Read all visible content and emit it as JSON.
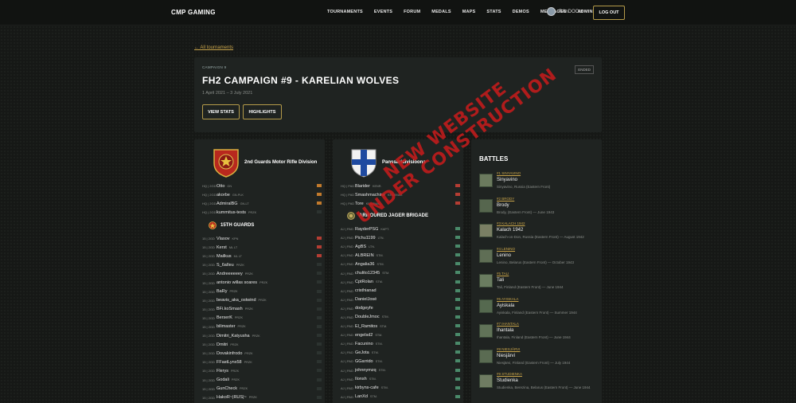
{
  "nav": {
    "brand": "CMP GAMING",
    "items": [
      "TOURNAMENTS",
      "EVENTS",
      "FORUM",
      "MEDALS",
      "MAPS",
      "STATS",
      "DEMOS",
      "MESSAGES",
      "ADMIN"
    ],
    "username": "RAnDOOm",
    "logout": "LOG OUT"
  },
  "back_link": "← All tournaments",
  "hero": {
    "kicker": "CAMPAIGN 9",
    "title": "FH2 CAMPAIGN #9 - KARELIAN WOLVES",
    "dates": "1 April 2021 – 3 July 2021",
    "badge": "ENDED",
    "view_stats": "VIEW STATS",
    "highlights": "HIGHLIGHTS"
  },
  "faction1": {
    "name": "2nd Guards Motor Rifle Division",
    "hq": [
      {
        "pos": "HQ | 2GD",
        "name": "Otto",
        "rank": "GN",
        "bar": "or"
      },
      {
        "pos": "HQ | 2GD",
        "name": "akorbe",
        "rank": "GN-PLK",
        "bar": "or"
      },
      {
        "pos": "HQ | 2GD",
        "name": "AdmiralBG",
        "rank": "GN-LT",
        "bar": "or"
      },
      {
        "pos": "HQ | 2GD",
        "name": "kummitus-tests",
        "rank": "PRZK",
        "bar": ""
      }
    ],
    "unit": "15TH GUARDS",
    "members": [
      {
        "pos": "15 | 2GD",
        "name": "Vlasov",
        "rank": "KPN",
        "bar": "rd"
      },
      {
        "pos": "15 | 2GD",
        "name": "Kerst",
        "rank": "ML LT",
        "bar": "rd"
      },
      {
        "pos": "15 | 2GD",
        "name": "Mailkus",
        "rank": "ML LT",
        "bar": "rd"
      },
      {
        "pos": "15 | 2GD",
        "name": "S_6aIleu",
        "rank": "PRZK",
        "bar": ""
      },
      {
        "pos": "15 | 2GD",
        "name": "Andreeeeeey",
        "rank": "PRZK",
        "bar": ""
      },
      {
        "pos": "15 | 2GD",
        "name": "antonio willas soares",
        "rank": "PRZK",
        "bar": ""
      },
      {
        "pos": "15 | 2GD",
        "name": "BaRy",
        "rank": "PRZK",
        "bar": ""
      },
      {
        "pos": "15 | 2GD",
        "name": "beavis_aka_ostwind",
        "rank": "PRZK",
        "bar": ""
      },
      {
        "pos": "15 | 2GD",
        "name": "BFi.koSmash",
        "rank": "PRZK",
        "bar": ""
      },
      {
        "pos": "15 | 2GD",
        "name": "BerserK",
        "rank": "PRZK",
        "bar": ""
      },
      {
        "pos": "15 | 2GD",
        "name": "bilimaster",
        "rank": "PRZK",
        "bar": ""
      },
      {
        "pos": "15 | 2GD",
        "name": "Dimitri_Katyusha",
        "rank": "PRZK",
        "bar": ""
      },
      {
        "pos": "15 | 2GD",
        "name": "Dmitri",
        "rank": "PRZK",
        "bar": ""
      },
      {
        "pos": "15 | 2GD",
        "name": "Dovakinfrodo",
        "rank": "PRZK",
        "bar": ""
      },
      {
        "pos": "15 | 2GD",
        "name": "FFastLynx58",
        "rank": "PRZK",
        "bar": ""
      },
      {
        "pos": "15 | 2GD",
        "name": "Flerys",
        "rank": "PRZK",
        "bar": ""
      },
      {
        "pos": "15 | 2GD",
        "name": "Godali",
        "rank": "PRZK",
        "bar": ""
      },
      {
        "pos": "15 | 2GD",
        "name": "GunCheck",
        "rank": "PRZK",
        "bar": ""
      },
      {
        "pos": "15 | 2GD",
        "name": "HakoR~|RUS|~",
        "rank": "PRZK",
        "bar": ""
      }
    ]
  },
  "faction2": {
    "name": "Panssaridivisioona",
    "hq": [
      {
        "pos": "HQ | PAD",
        "name": "Blarider",
        "rank": "KENR.",
        "bar": "rd"
      },
      {
        "pos": "HQ | PAD",
        "name": "Smashmachine",
        "rank": "KENRMAJ.",
        "bar": "rd"
      },
      {
        "pos": "HQ | PAD",
        "name": "Tore",
        "rank": "KENRMAJ.",
        "bar": "rd"
      }
    ],
    "unit": "ARMOURED JAGER BRIGADE",
    "members": [
      {
        "pos": "AJ | PAD",
        "name": "RayderPSG",
        "rank": "KAPT.",
        "bar": "gr"
      },
      {
        "pos": "AJ | PAD",
        "name": "Pichu1199",
        "rank": "LTN.",
        "bar": "gr"
      },
      {
        "pos": "AJ | PAD",
        "name": "AgBS",
        "rank": "LTN.",
        "bar": "gr"
      },
      {
        "pos": "AJ | PAD",
        "name": "ALBREIN",
        "rank": "STM.",
        "bar": "gr"
      },
      {
        "pos": "AJ | PAD",
        "name": "Angalia36",
        "rank": "STM.",
        "bar": "gr"
      },
      {
        "pos": "AJ | PAD",
        "name": "chulito12345",
        "rank": "STM.",
        "bar": "gr"
      },
      {
        "pos": "AJ | PAD",
        "name": "CptRolan",
        "rank": "STM.",
        "bar": "gr"
      },
      {
        "pos": "AJ | PAD",
        "name": "cristhianad",
        "rank": "",
        "bar": "gr"
      },
      {
        "pos": "AJ | PAD",
        "name": "DanielJosé",
        "rank": "",
        "bar": "gr"
      },
      {
        "pos": "AJ | PAD",
        "name": "dodgeyfe",
        "rank": "",
        "bar": "gr"
      },
      {
        "pos": "AJ | PAD",
        "name": "DoubleJmoc",
        "rank": "STM.",
        "bar": "gr"
      },
      {
        "pos": "AJ | PAD",
        "name": "El_Ramitos",
        "rank": "STM.",
        "bar": "gr"
      },
      {
        "pos": "AJ | PAD",
        "name": "engelsd2",
        "rank": "STM.",
        "bar": "gr"
      },
      {
        "pos": "AJ | PAD",
        "name": "Facunino",
        "rank": "STM.",
        "bar": "gr"
      },
      {
        "pos": "AJ | PAD",
        "name": "GeJota",
        "rank": "STM.",
        "bar": "gr"
      },
      {
        "pos": "AJ | PAD",
        "name": "GGarrido",
        "rank": "STM.",
        "bar": "gr"
      },
      {
        "pos": "AJ | PAD",
        "name": "johnnymzq",
        "rank": "STM.",
        "bar": "gr"
      },
      {
        "pos": "AJ | PAD",
        "name": "Ilonsh",
        "rank": "STM.",
        "bar": "gr"
      },
      {
        "pos": "AJ | PAD",
        "name": "kirbyns-cafe",
        "rank": "STM.",
        "bar": "gr"
      },
      {
        "pos": "AJ | PAD",
        "name": "LanXd",
        "rank": "STM.",
        "bar": "gr"
      }
    ]
  },
  "battles": {
    "title": "BATTLES",
    "items": [
      {
        "tag": "#1 SINYAVINO",
        "name": "Sinyavino",
        "desc": "Sinyavino, Russia (Eastern Front)"
      },
      {
        "tag": "#2 BRODY",
        "name": "Brody",
        "desc": "Brody, (Eastern Front) — June 1943"
      },
      {
        "tag": "#3 KALACH 1942",
        "name": "Kalach 1942",
        "desc": "Kalach-on-Don, Russia (Eastern Front) — August 1942"
      },
      {
        "tag": "#4 LENINO",
        "name": "Lenino",
        "desc": "Lenino, Belarus (Eastern Front) — October 1943"
      },
      {
        "tag": "#5 TALI",
        "name": "Tali",
        "desc": "Tali, Finland (Eastern Front) — June 1944"
      },
      {
        "tag": "#6 AYISKALA",
        "name": "Ayiskala",
        "desc": "Ayiskala, Finland (Eastern Front) — Summer 1944"
      },
      {
        "tag": "#7 IHANTALA",
        "name": "Ihantala",
        "desc": "Ihantala, Finland (Eastern Front) — June 1944"
      },
      {
        "tag": "#8 NIESJÄRVI",
        "name": "Niesjärvi",
        "desc": "Niesjärvi, Finland (Eastern Front) — July 1944"
      },
      {
        "tag": "#9 STUDIENKA",
        "name": "Studienka",
        "desc": "Studienka, Berezina, Belarus (Eastern Front) — June 1944"
      }
    ]
  },
  "stamp": {
    "line1": "NEW WEBSITE",
    "line2": "UNDER CONSTRUCTION"
  },
  "colors": {
    "accent": "#c8a44a",
    "stamp": "#c41c1c",
    "panel": "#1f2321"
  }
}
